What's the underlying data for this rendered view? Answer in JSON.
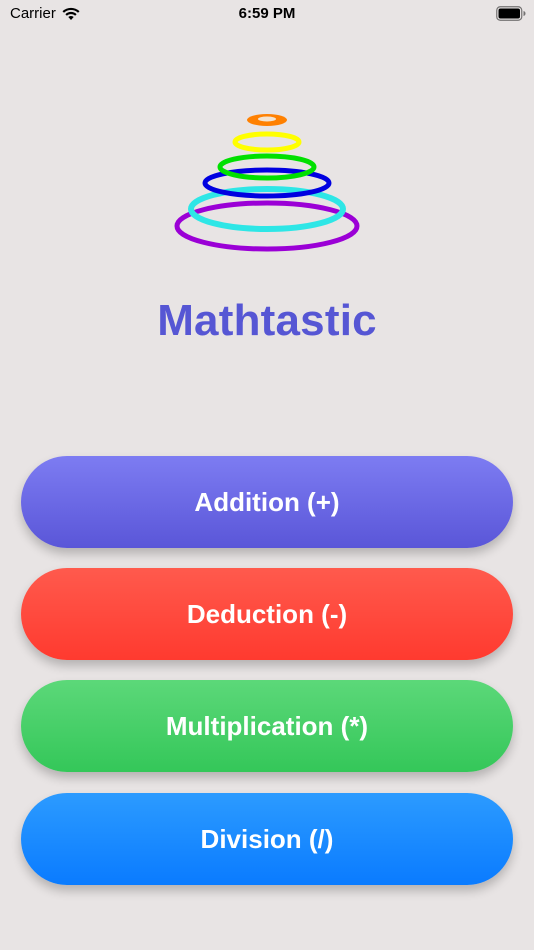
{
  "status_bar": {
    "carrier": "Carrier",
    "time": "6:59 PM",
    "wifi_icon": "wifi-icon",
    "battery_icon": "battery-icon"
  },
  "logo": {
    "icon": "rainbow-rings-icon",
    "colors": [
      "#9b00d6",
      "#2ee6e6",
      "#0000e0",
      "#00e000",
      "#ffff00",
      "#ff8000"
    ]
  },
  "app": {
    "title": "Mathtastic",
    "title_color": "#5656d4"
  },
  "buttons": {
    "addition": "Addition (+)",
    "deduction": "Deduction (-)",
    "multiplication": "Multiplication (*)",
    "division": "Division (/)"
  },
  "colors": {
    "background": "#e8e4e4",
    "addition": "#6a68e6",
    "deduction": "#ff4a3e",
    "multiplication": "#40cc64",
    "division": "#1a8aff"
  }
}
